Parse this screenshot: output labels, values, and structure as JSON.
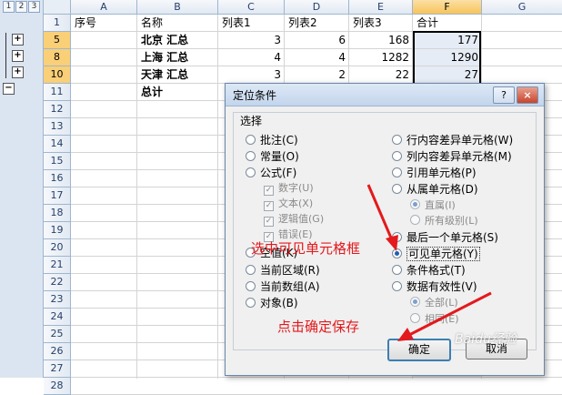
{
  "outline": {
    "levels": [
      "1",
      "2",
      "3"
    ],
    "expand_symbol": "+",
    "collapse_symbol": "−"
  },
  "columns": [
    "A",
    "B",
    "C",
    "D",
    "E",
    "F",
    "G"
  ],
  "rows": [
    "1",
    "5",
    "8",
    "10",
    "11",
    "12",
    "13",
    "14",
    "15",
    "16",
    "17",
    "18",
    "19",
    "20",
    "21",
    "22",
    "23",
    "24",
    "25",
    "26",
    "27",
    "28"
  ],
  "header_row": {
    "a": "序号",
    "b": "名称",
    "c": "列表1",
    "d": "列表2",
    "e": "列表3",
    "f": "合计"
  },
  "data_rows": [
    {
      "name": "北京  汇总",
      "c": "3",
      "d": "6",
      "e": "168",
      "f": "177"
    },
    {
      "name": "上海  汇总",
      "c": "4",
      "d": "4",
      "e": "1282",
      "f": "1290"
    },
    {
      "name": "天津  汇总",
      "c": "3",
      "d": "2",
      "e": "22",
      "f": "27"
    }
  ],
  "total_label": "总计",
  "dialog": {
    "title": "定位条件",
    "help": "?",
    "close": "×",
    "group_label": "选择",
    "left_options": [
      "批注(C)",
      "常量(O)",
      "公式(F)",
      "空值(K)",
      "当前区域(R)",
      "当前数组(A)",
      "对象(B)"
    ],
    "formula_subs": [
      "数字(U)",
      "文本(X)",
      "逻辑值(G)",
      "错误(E)"
    ],
    "right_options": [
      "行内容差异单元格(W)",
      "列内容差异单元格(M)",
      "引用单元格(P)",
      "从属单元格(D)",
      "最后一个单元格(S)",
      "可见单元格(Y)",
      "条件格式(T)",
      "数据有效性(V)"
    ],
    "dep_subs": [
      "直属(I)",
      "所有级别(L)"
    ],
    "valid_subs": [
      "全部(L)",
      "相同(E)"
    ],
    "ok": "确定",
    "cancel": "取消"
  },
  "annotations": {
    "select_visible": "选中可见单元格框",
    "click_ok": "点击确定保存"
  },
  "watermark": "Baidu经验",
  "colors": {
    "annotation": "#e3191d",
    "selection": "#f9cf77"
  }
}
